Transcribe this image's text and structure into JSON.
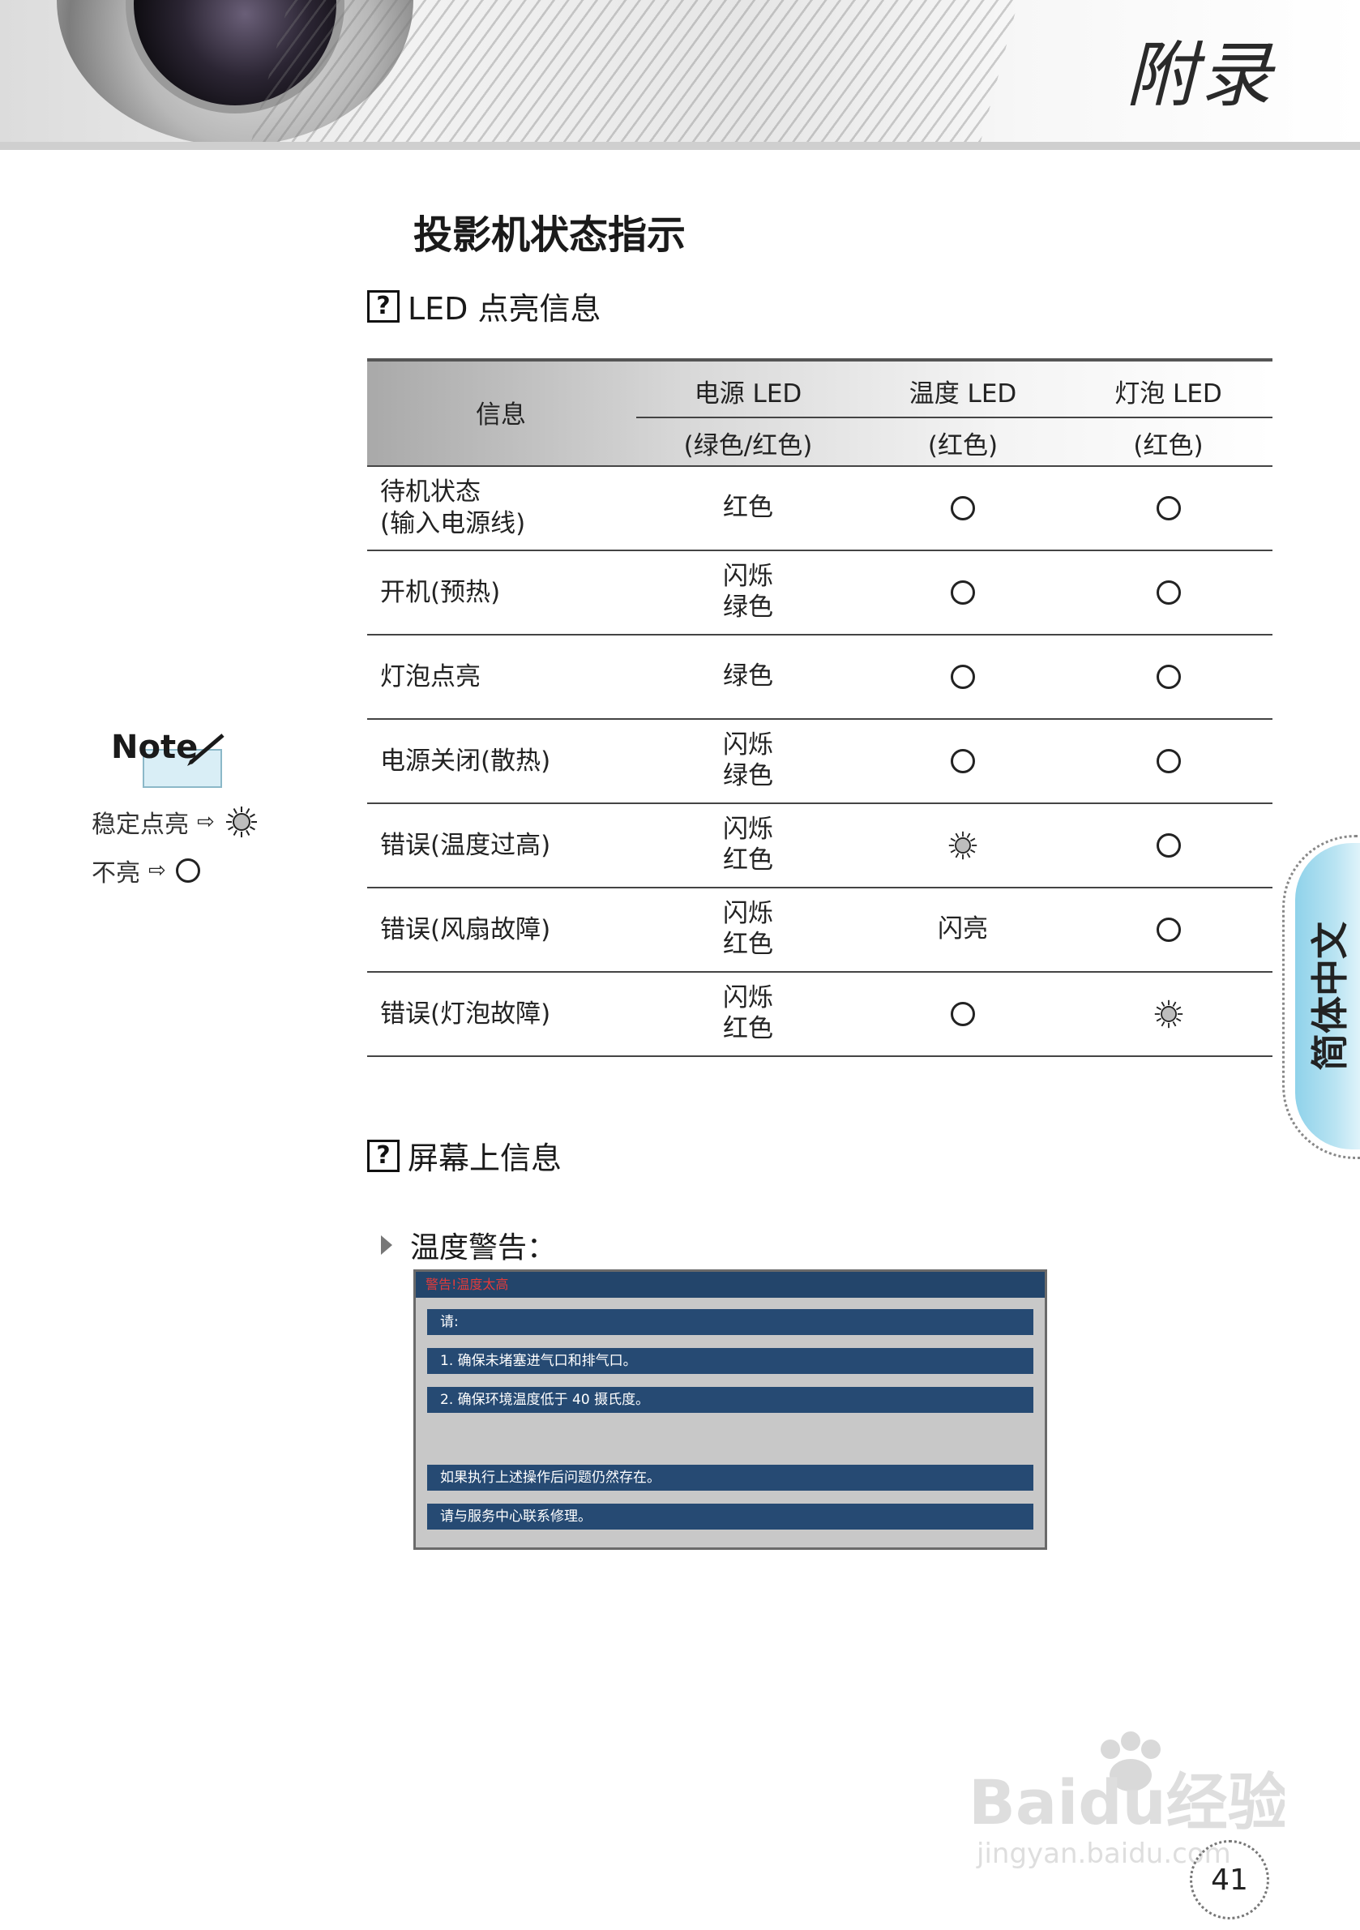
{
  "header": {
    "title": "附录"
  },
  "page_title": "投影机状态指示",
  "section_led": {
    "icon": "question-box-icon",
    "icon_glyph": "?",
    "title": "LED 点亮信息"
  },
  "table": {
    "header": {
      "info": "信息",
      "power": "电源 LED",
      "power_sub": "(绿色/红色)",
      "temp": "温度 LED",
      "temp_sub": "(红色)",
      "lamp": "灯泡 LED",
      "lamp_sub": "(红色)"
    },
    "rows": [
      {
        "label": [
          "待机状态",
          "(输入电源线)"
        ],
        "power": [
          "红色"
        ],
        "temp": "off",
        "lamp": "off"
      },
      {
        "label": [
          "开机(预热)"
        ],
        "power": [
          "闪烁",
          "绿色"
        ],
        "temp": "off",
        "lamp": "off"
      },
      {
        "label": [
          "灯泡点亮"
        ],
        "power": [
          "绿色"
        ],
        "temp": "off",
        "lamp": "off"
      },
      {
        "label": [
          "电源关闭(散热)"
        ],
        "power": [
          "闪烁",
          "绿色"
        ],
        "temp": "off",
        "lamp": "off"
      },
      {
        "label": [
          "错误(温度过高)"
        ],
        "power": [
          "闪烁",
          "红色"
        ],
        "temp": "on",
        "lamp": "off"
      },
      {
        "label": [
          "错误(风扇故障)"
        ],
        "power": [
          "闪烁",
          "红色"
        ],
        "temp": "闪亮",
        "lamp": "off"
      },
      {
        "label": [
          "错误(灯泡故障)"
        ],
        "power": [
          "闪烁",
          "红色"
        ],
        "temp": "off",
        "lamp": "on"
      }
    ]
  },
  "note": {
    "logo_text": "Note",
    "steady_label": "稳定点亮",
    "off_label": "不亮",
    "arrow": "⇨"
  },
  "side_tab": {
    "label": "简体中文"
  },
  "section_osd": {
    "icon": "question-box-icon",
    "icon_glyph": "?",
    "title": "屏幕上信息"
  },
  "warning": {
    "heading": "温度警告：",
    "dialog_title": "警告!温度太高",
    "lines": [
      "请:",
      "1. 确保未堵塞进气口和排气口。",
      "2. 确保环境温度低于 40 摄氏度。",
      "",
      "如果执行上述操作后问题仍然存在。",
      "请与服务中心联系修理。"
    ]
  },
  "watermark": {
    "text": "Baidu经验",
    "sub": "jingyan.baidu.com"
  },
  "page_number": "41",
  "colors": {
    "dialog_bar": "#264a73",
    "dialog_title_text": "#e23b3b",
    "side_tab": "#8fd2ea"
  }
}
